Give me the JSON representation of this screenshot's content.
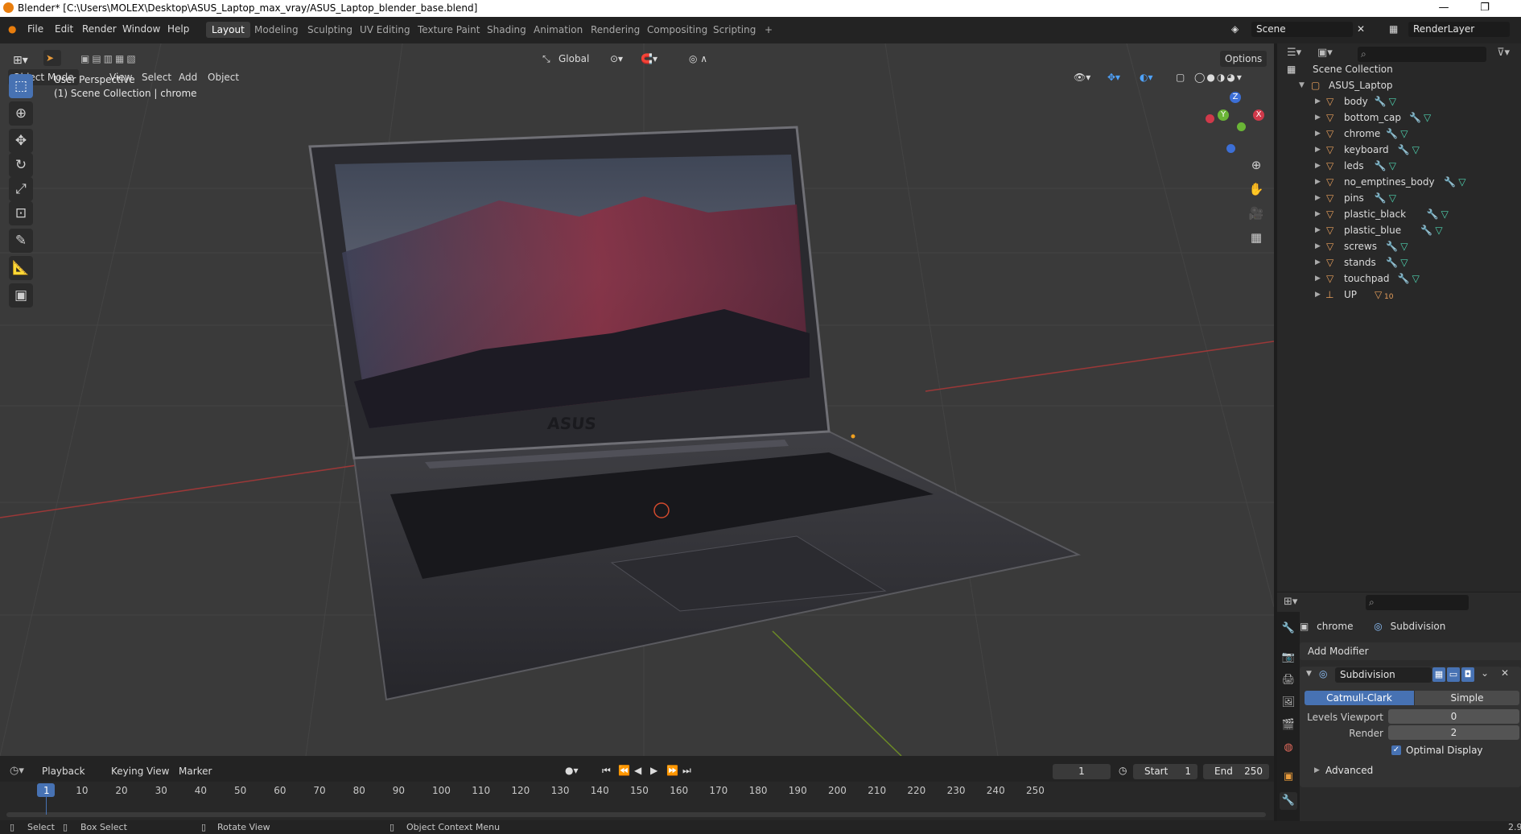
{
  "window": {
    "title": "Blender* [C:\\Users\\MOLEX\\Desktop\\ASUS_Laptop_max_vray/ASUS_Laptop_blender_base.blend]",
    "minimize": "—",
    "maximize": "❐"
  },
  "menu": [
    "File",
    "Edit",
    "Render",
    "Window",
    "Help"
  ],
  "workspaces": [
    "Layout",
    "Modeling",
    "Sculpting",
    "UV Editing",
    "Texture Paint",
    "Shading",
    "Animation",
    "Rendering",
    "Compositing",
    "Scripting"
  ],
  "add_workspace": "+",
  "scene": "Scene",
  "render_layer": "RenderLayer",
  "viewport": {
    "mode": "Object Mode",
    "menus": [
      "View",
      "Select",
      "Add",
      "Object"
    ],
    "orientation": "Global",
    "options": "Options",
    "overlay_title": "User Perspective",
    "overlay_subtitle": "(1) Scene Collection | chrome",
    "gizmo": {
      "z": "Z",
      "y": "Y",
      "x": "X"
    },
    "logo_text": "ASUS"
  },
  "outliner": {
    "root": "Scene Collection",
    "collection": "ASUS_Laptop",
    "items": [
      {
        "name": "body"
      },
      {
        "name": "bottom_cap"
      },
      {
        "name": "chrome"
      },
      {
        "name": "keyboard"
      },
      {
        "name": "leds"
      },
      {
        "name": "no_emptines_body"
      },
      {
        "name": "pins"
      },
      {
        "name": "plastic_black"
      },
      {
        "name": "plastic_blue"
      },
      {
        "name": "screws"
      },
      {
        "name": "stands"
      },
      {
        "name": "touchpad"
      }
    ],
    "empty": {
      "name": "UP",
      "child_count": "10"
    }
  },
  "properties": {
    "object": "chrome",
    "modifier_context": "Subdivision",
    "add_modifier": "Add Modifier",
    "modifier_name": "Subdivision",
    "mode_catmull": "Catmull-Clark",
    "mode_simple": "Simple",
    "levels_viewport_label": "Levels Viewport",
    "levels_viewport_value": "0",
    "render_label": "Render",
    "render_value": "2",
    "optimal_display": "Optimal Display",
    "advanced": "Advanced"
  },
  "timeline": {
    "menus": [
      "Playback",
      "Keying",
      "View",
      "Marker"
    ],
    "current_frame": "1",
    "start_label": "Start",
    "start": "1",
    "end_label": "End",
    "end": "250",
    "ticks": [
      "1",
      "10",
      "20",
      "30",
      "40",
      "50",
      "60",
      "70",
      "80",
      "90",
      "100",
      "110",
      "120",
      "130",
      "140",
      "150",
      "160",
      "170",
      "180",
      "190",
      "200",
      "210",
      "220",
      "230",
      "240",
      "250"
    ]
  },
  "status": {
    "select": "Select",
    "box_select": "Box Select",
    "rotate_view": "Rotate View",
    "context_menu": "Object Context Menu",
    "version": "2.9"
  },
  "colors": {
    "accent": "#4772b3",
    "header": "#232323",
    "viewport": "#3a3a3a",
    "panel": "#282828"
  }
}
